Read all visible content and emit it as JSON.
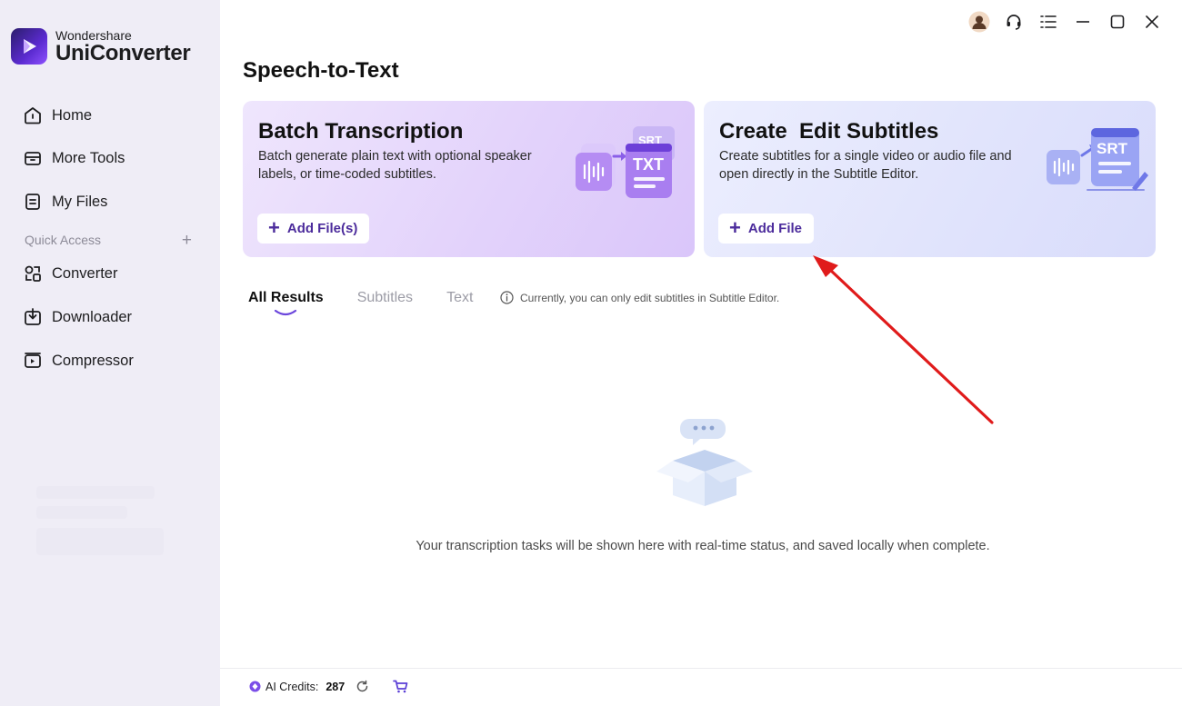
{
  "brand": {
    "top": "Wondershare",
    "name": "UniConverter"
  },
  "sidebar": {
    "items": [
      {
        "label": "Home",
        "icon": "home-icon"
      },
      {
        "label": "More Tools",
        "icon": "toolbox-icon"
      },
      {
        "label": "My Files",
        "icon": "file-icon"
      }
    ],
    "quick_access_label": "Quick Access",
    "quick_access_add": "+",
    "tools": [
      {
        "label": "Converter",
        "icon": "converter-icon"
      },
      {
        "label": "Downloader",
        "icon": "downloader-icon"
      },
      {
        "label": "Compressor",
        "icon": "compressor-icon"
      }
    ]
  },
  "page": {
    "title": "Speech-to-Text"
  },
  "cards": {
    "batch": {
      "title": "Batch Transcription",
      "description": "Batch generate plain text with optional speaker labels, or time-coded subtitles.",
      "button": "Add File(s)",
      "illus_front": "TXT",
      "illus_back": "SRT"
    },
    "subtitles": {
      "title": "Create  Edit Subtitles",
      "description": "Create subtitles for a single video or audio file and open directly in the Subtitle Editor.",
      "button": "Add File",
      "illus_tag": "SRT"
    }
  },
  "tabs": [
    {
      "label": "All Results",
      "active": true
    },
    {
      "label": "Subtitles",
      "active": false
    },
    {
      "label": "Text",
      "active": false
    }
  ],
  "notice": "Currently, you can only edit subtitles in Subtitle Editor.",
  "empty_state": "Your transcription tasks will be shown here with real-time status, and saved locally when complete.",
  "footer": {
    "credits_label": "AI Credits:",
    "credits_value": "287"
  },
  "colors": {
    "accent": "#4c2c9c",
    "sidebar_bg": "#efedf6",
    "arrow": "#e01b1b"
  }
}
